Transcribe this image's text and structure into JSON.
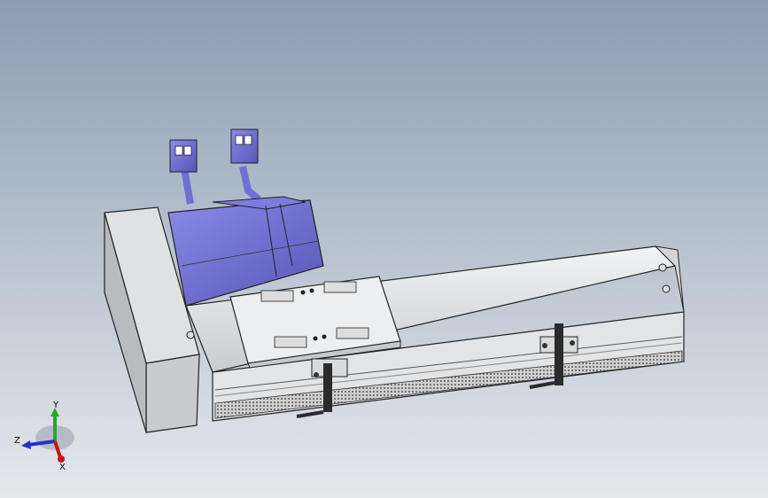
{
  "viewport": {
    "background_top": "#8a9db3",
    "background_bottom": "#e6e8ec"
  },
  "model": {
    "motor_color": "#6f6fd6",
    "body_color": "#e4e6e8",
    "edge_color": "#2a2a2a",
    "belt_color": "#5a5a5a",
    "clamp_color": "#2b2b2b"
  },
  "triad": {
    "y_label": "Y",
    "z_label": "Z",
    "x_label": "X",
    "y_color": "#22aa22",
    "z_color": "#2233cc",
    "x_color": "#cc1111"
  }
}
